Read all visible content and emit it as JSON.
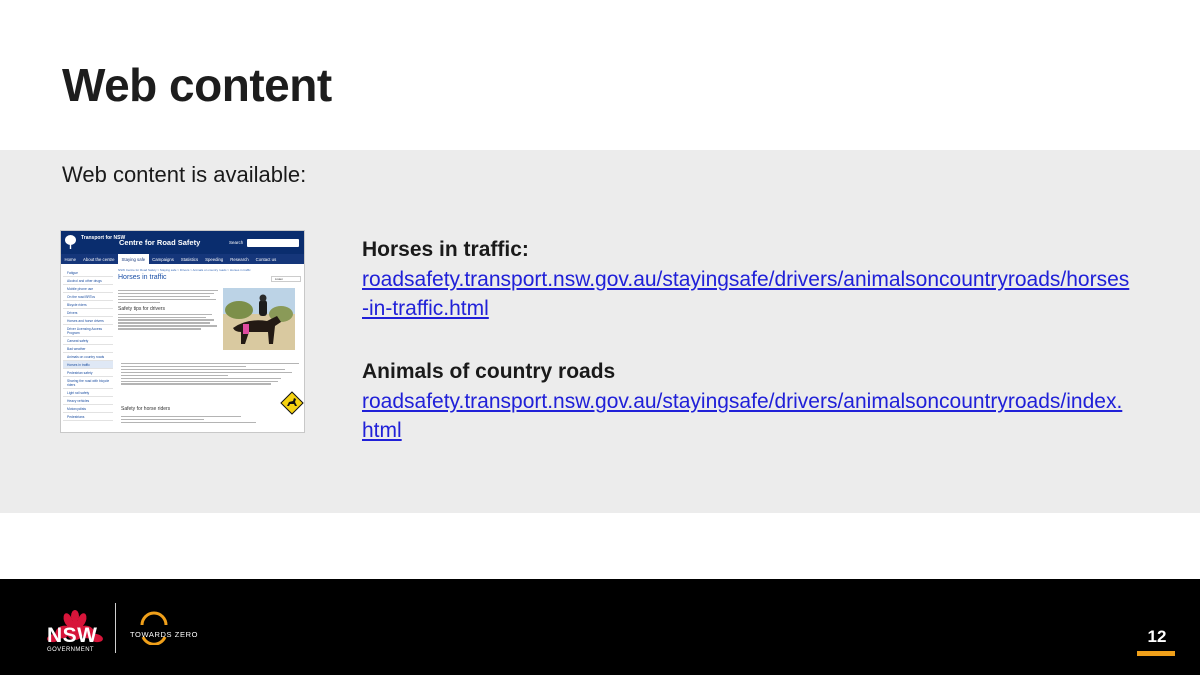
{
  "slide": {
    "title": "Web content",
    "intro": "Web content is available:",
    "page_number": "12"
  },
  "links": [
    {
      "heading": "Horses in traffic:",
      "url": "roadsafety.transport.nsw.gov.au/stayingsafe/drivers/animalsoncountryroads/horses-in-traffic.html"
    },
    {
      "heading": "Animals of country roads",
      "url": "roadsafety.transport.nsw.gov.au/stayingsafe/drivers/animalsoncountryroads/index.html"
    }
  ],
  "thumbnail": {
    "agency": "Transport for NSW",
    "site_name": "Centre for Road Safety",
    "search_label": "Search",
    "nav": [
      "Home",
      "About the centre",
      "Staying safe",
      "Campaigns",
      "Statistics",
      "Speeding",
      "Research",
      "Contact us"
    ],
    "active_nav": "Staying safe",
    "sidebar": [
      "Fatigue",
      "Alcohol and other drugs",
      "Mobile phone use",
      "On the road BRTos",
      "Bicycle riders",
      "Drivers",
      "Horses and horse drivers",
      "Driver Licensing Access Program",
      "Carseat safety",
      "Bad weather",
      "Animals on country roads",
      "Horses in traffic",
      "Pedestrian safety",
      "Sharing the road with bicycle riders",
      "Light rail safety",
      "Heavy vehicles",
      "Motorcyclists",
      "Pedestrians"
    ],
    "breadcrumb": "NSW Centre for Road Safety > Staying safe > Drivers > Animals on country roads > Horses in traffic",
    "page_title": "Horses in traffic",
    "listen_label": "Listen",
    "subhead_drivers": "Safety tips for drivers",
    "subhead_riders": "Safety for horse riders"
  },
  "footer": {
    "gov_name": "NSW",
    "gov_sub": "GOVERNMENT",
    "partner": "TOWARDS ZERO"
  },
  "colors": {
    "link": "#2020d8",
    "panel_bg": "#ececec",
    "footer_bg": "#000000",
    "accent": "#f0a01a",
    "nsw_red": "#d7153a"
  }
}
